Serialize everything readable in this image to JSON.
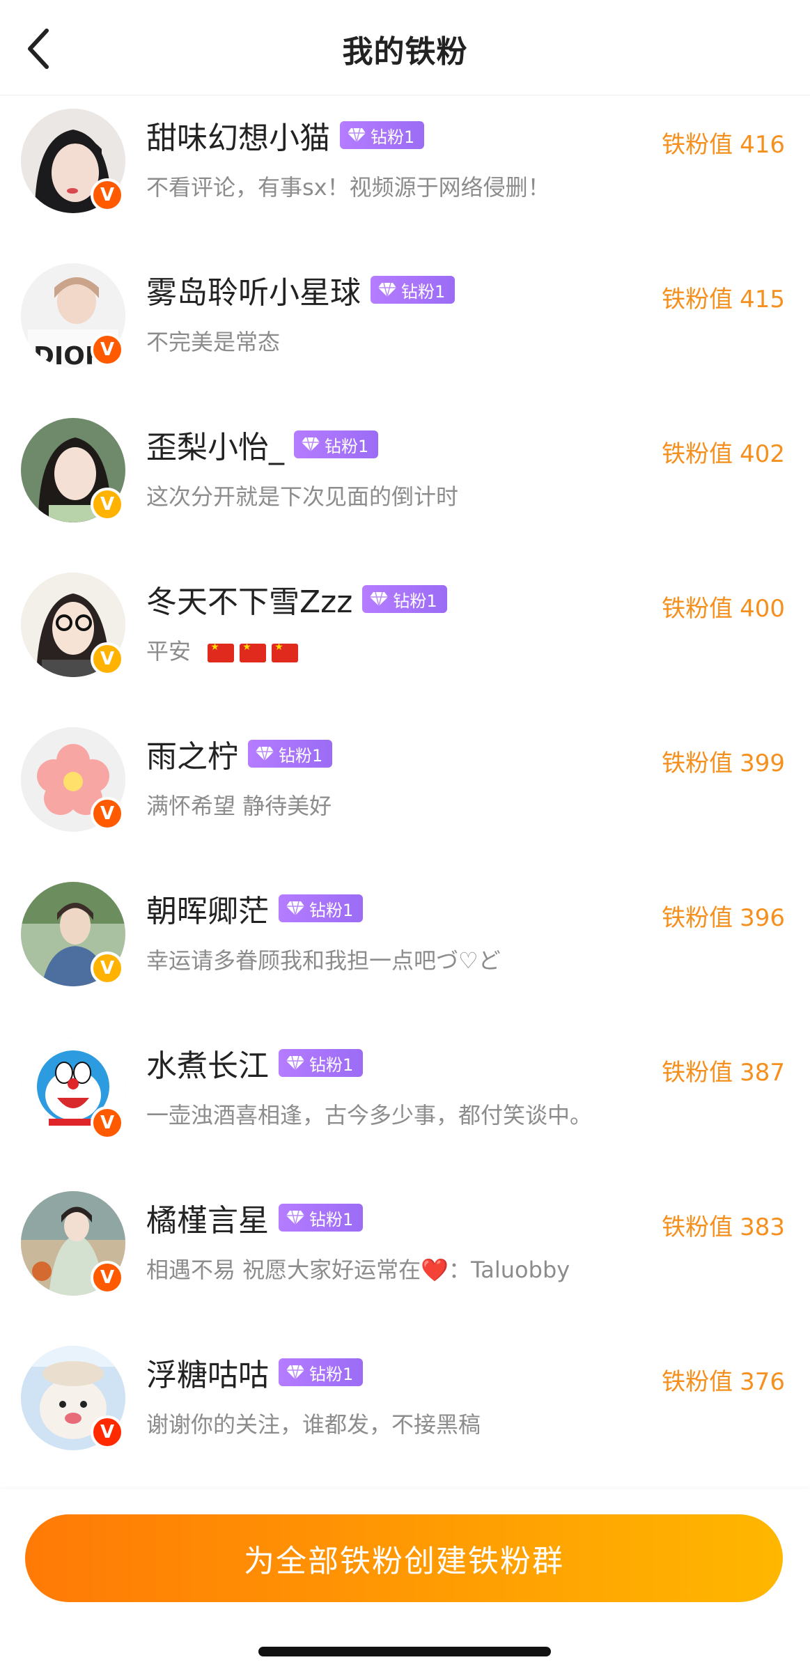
{
  "header": {
    "title": "我的铁粉",
    "back_icon": "chevron-left-icon"
  },
  "score_label": "铁粉值",
  "fans": [
    {
      "name": "甜味幻想小猫",
      "badge": "钻粉1",
      "score": "416",
      "signature": "不看评论，有事sx！视频源于网络侵删！",
      "v_color": "#ff6a00"
    },
    {
      "name": "雾岛聆听小星球",
      "badge": "钻粉1",
      "score": "415",
      "signature": "不完美是常态",
      "v_color": "#ff6a00"
    },
    {
      "name": "歪梨小怡_",
      "badge": "钻粉1",
      "score": "402",
      "signature": "这次分开就是下次见面的倒计时",
      "v_color": "#ffb300"
    },
    {
      "name": "冬天不下雪Zzz",
      "badge": "钻粉1",
      "score": "400",
      "signature": "平安",
      "flags": 3,
      "v_color": "#ffb300"
    },
    {
      "name": "雨之柠",
      "badge": "钻粉1",
      "score": "399",
      "signature": "满怀希望 静待美好",
      "v_color": "#ff6a00"
    },
    {
      "name": "朝晖卿茫",
      "badge": "钻粉1",
      "score": "396",
      "signature": "幸运请多眷顾我和我担一点吧づ♡ど",
      "v_color": "#ffb300"
    },
    {
      "name": "水煮长江",
      "badge": "钻粉1",
      "score": "387",
      "signature": "一壶浊酒喜相逢，古今多少事，都付笑谈中。",
      "v_color": "#ff6a00"
    },
    {
      "name": "橘槿言星",
      "badge": "钻粉1",
      "score": "383",
      "signature": "相遇不易 祝愿大家好运常在❤️：Taluobby",
      "v_color": "#ff6a00"
    },
    {
      "name": "浮糖咕咕",
      "badge": "钻粉1",
      "score": "376",
      "signature": "谢谢你的关注，谁都发，不接黑稿",
      "v_color": "#ff2a00"
    }
  ],
  "cta": {
    "label": "为全部铁粉创建铁粉群"
  },
  "colors": {
    "score": "#f5901e",
    "badge": "#a874f7",
    "cta_start": "#ff7a06",
    "cta_end": "#ffb700"
  }
}
